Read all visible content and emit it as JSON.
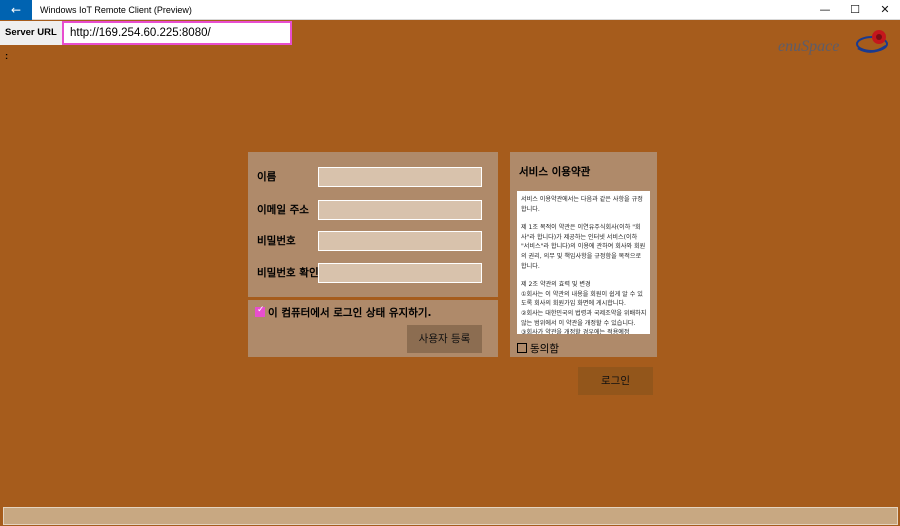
{
  "window": {
    "title": "Windows IoT Remote Client (Preview)",
    "back_icon": "←",
    "minimize_icon": "—",
    "maximize_icon": "☐",
    "close_icon": "✕"
  },
  "server": {
    "label": "Server URL :",
    "url": "http://169.254.60.225:8080/"
  },
  "logo": {
    "text": "enuSpace"
  },
  "form": {
    "name_label": "이름",
    "email_label": "이메일 주소",
    "password_label": "비밀번호",
    "password_confirm_label": "비밀번호 확인",
    "remember_label": "이 컴퓨터에서 로그인 상태 유지하기.",
    "remember_checked": true,
    "register_label": "사용자 등록"
  },
  "terms": {
    "title": "서비스 이용약관",
    "paragraphs": [
      "서비스 이용약관에서는 다음과 같은 사항을 규정합니다.",
      "제 1조 목적이 약관은 이연유주식회사(이하 \"회사\"라 합니다)가 제공하는 인터넷 서비스(이하 \"서비스\"라 합니다)의 이용에 관하여 회사와 회원의 권리, 의무 및 책임사항을 규정함을 목적으로 합니다.",
      "제 2조 약관의 효력 및 변경\n①회사는 이 약관의 내용을 회원이 쉽게 알 수 있도록 회사의 회원가입 화면에 게시합니다.\n②회사는 대한민국의 법령과 국제조약을 위배하지 않는 범위에서 이 약관을 개정할 수 있습니다.\n③회사가 약관을 개정할 경우에는 적용예정"
    ],
    "agree_label": "동의함",
    "agree_checked": false
  },
  "login_label": "로그인",
  "colors": {
    "background": "#a65c1c",
    "panel": "#af8a6a",
    "accent": "#e84ecf",
    "title_back": "#0063b1"
  }
}
